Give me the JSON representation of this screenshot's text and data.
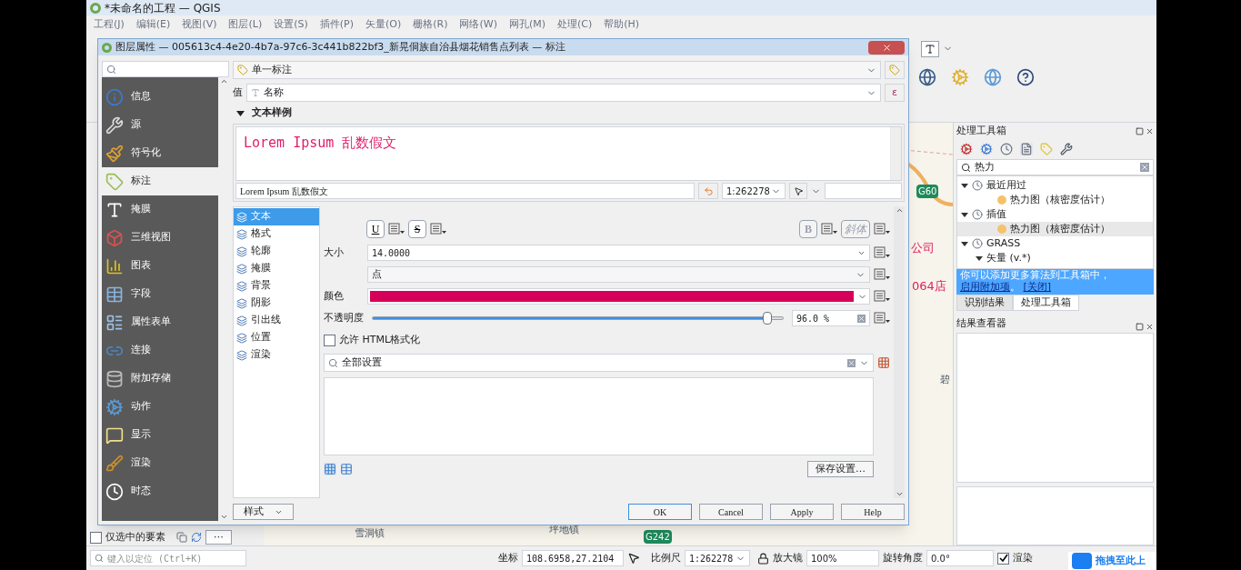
{
  "main_window": {
    "title": "*未命名的工程 — QGIS"
  },
  "menu": [
    "工程(J)",
    "编辑(E)",
    "视图(V)",
    "图层(L)",
    "设置(S)",
    "插件(P)",
    "矢量(O)",
    "栅格(R)",
    "网络(W)",
    "网孔(M)",
    "处理(C)",
    "帮助(H)"
  ],
  "map_labels": [
    {
      "text": "G60",
      "kind": "shield"
    },
    {
      "text": "公司",
      "kind": "poi"
    },
    {
      "text": "064店",
      "kind": "poi"
    },
    {
      "text": "碧",
      "kind": "place"
    },
    {
      "text": "雪洞镇",
      "kind": "place"
    },
    {
      "text": "坪地镇",
      "kind": "place"
    },
    {
      "text": "G242",
      "kind": "shield"
    }
  ],
  "layer_panel": {
    "selected_only": {
      "label": "仅选中的要素",
      "checked": false
    },
    "more": "⋯"
  },
  "toolbox": {
    "title": "处理工具箱",
    "search": "热力",
    "tree": [
      {
        "label": "最近用过",
        "selected": false,
        "expanded": true,
        "children": [
          {
            "label": "热力图（核密度估计）",
            "selected": false
          }
        ]
      },
      {
        "label": "插值",
        "selected": false,
        "expanded": true,
        "children": [
          {
            "label": "热力图（核密度估计）",
            "selected": true
          }
        ]
      },
      {
        "label": "GRASS",
        "selected": false,
        "expanded": true,
        "children": [
          {
            "label": "矢量 (v.*)",
            "selected": false,
            "expanded": true
          }
        ]
      }
    ],
    "notice": {
      "text": "你可以添加更多算法到工具箱中，",
      "link": "启用附加项",
      "after": "。",
      "close": "[关闭]"
    },
    "tabs": [
      {
        "label": "识别结果",
        "selected": false
      },
      {
        "label": "处理工具箱",
        "selected": true
      }
    ]
  },
  "results_viewer": {
    "title": "结果查看器"
  },
  "status_bar": {
    "locator_placeholder": "键入以定位 (Ctrl+K)",
    "coordinate_label": "坐标",
    "coordinate": "108.6958,27.2104",
    "scale_label": "比例尺",
    "scale": "1:262278",
    "magnifier_label": "放大镜",
    "magnifier": "100%",
    "rotation_label": "旋转角度",
    "rotation": "0.0°",
    "render": {
      "label": "渲染",
      "checked": true
    }
  },
  "upload_overlay": {
    "text": "拖拽至此上"
  },
  "dialog": {
    "title": "图层属性 — 005613c4-4e20-4b7a-97c6-3c441b822bf3_新晃侗族自治县烟花销售点列表 — 标注",
    "sections": [
      {
        "label": "信息",
        "selected": false
      },
      {
        "label": "源",
        "selected": false
      },
      {
        "label": "符号化",
        "selected": false
      },
      {
        "label": "标注",
        "selected": true
      },
      {
        "label": "掩膜",
        "selected": false
      },
      {
        "label": "三维视图",
        "selected": false
      },
      {
        "label": "图表",
        "selected": false
      },
      {
        "label": "字段",
        "selected": false
      },
      {
        "label": "属性表单",
        "selected": false
      },
      {
        "label": "连接",
        "selected": false
      },
      {
        "label": "附加存储",
        "selected": false
      },
      {
        "label": "动作",
        "selected": false
      },
      {
        "label": "显示",
        "selected": false
      },
      {
        "label": "渲染",
        "selected": false
      },
      {
        "label": "时态",
        "selected": false
      }
    ],
    "label_mode": "单一标注",
    "value_label": "值",
    "value": "名称",
    "expression_symbol": "ε",
    "sample_header": "文本样例",
    "sample_expanded": true,
    "preview_text": "Lorem Ipsum 乱数假文",
    "sample_input": "Lorem Ipsum 乱数假文",
    "sample_scale": "1:262278",
    "tabs": [
      {
        "label": "文本",
        "selected": true
      },
      {
        "label": "格式",
        "selected": false
      },
      {
        "label": "轮廓",
        "selected": false
      },
      {
        "label": "掩膜",
        "selected": false
      },
      {
        "label": "背景",
        "selected": false
      },
      {
        "label": "阴影",
        "selected": false
      },
      {
        "label": "引出线",
        "selected": false
      },
      {
        "label": "位置",
        "selected": false
      },
      {
        "label": "渲染",
        "selected": false
      }
    ],
    "format_buttons": [
      {
        "label": "U",
        "kind": "underline",
        "disabled": false
      },
      {
        "label": "S",
        "kind": "strikeout",
        "disabled": false
      },
      {
        "label": "B",
        "kind": "bold",
        "disabled": true
      },
      {
        "label": "斜体",
        "kind": "italic",
        "disabled": true
      }
    ],
    "size_label": "大小",
    "size": "14.0000",
    "unit": "点",
    "color_label": "颜色",
    "opacity_label": "不透明度",
    "opacity": {
      "level": 0.96,
      "reading": "96.0 %"
    },
    "allow_html": {
      "label": "允许 HTML格式化",
      "checked": false
    },
    "settings_search": "全部设置",
    "save_settings": "保存设置…",
    "style_menu": "样式",
    "buttons": [
      "OK",
      "Cancel",
      "Apply",
      "Help"
    ]
  }
}
